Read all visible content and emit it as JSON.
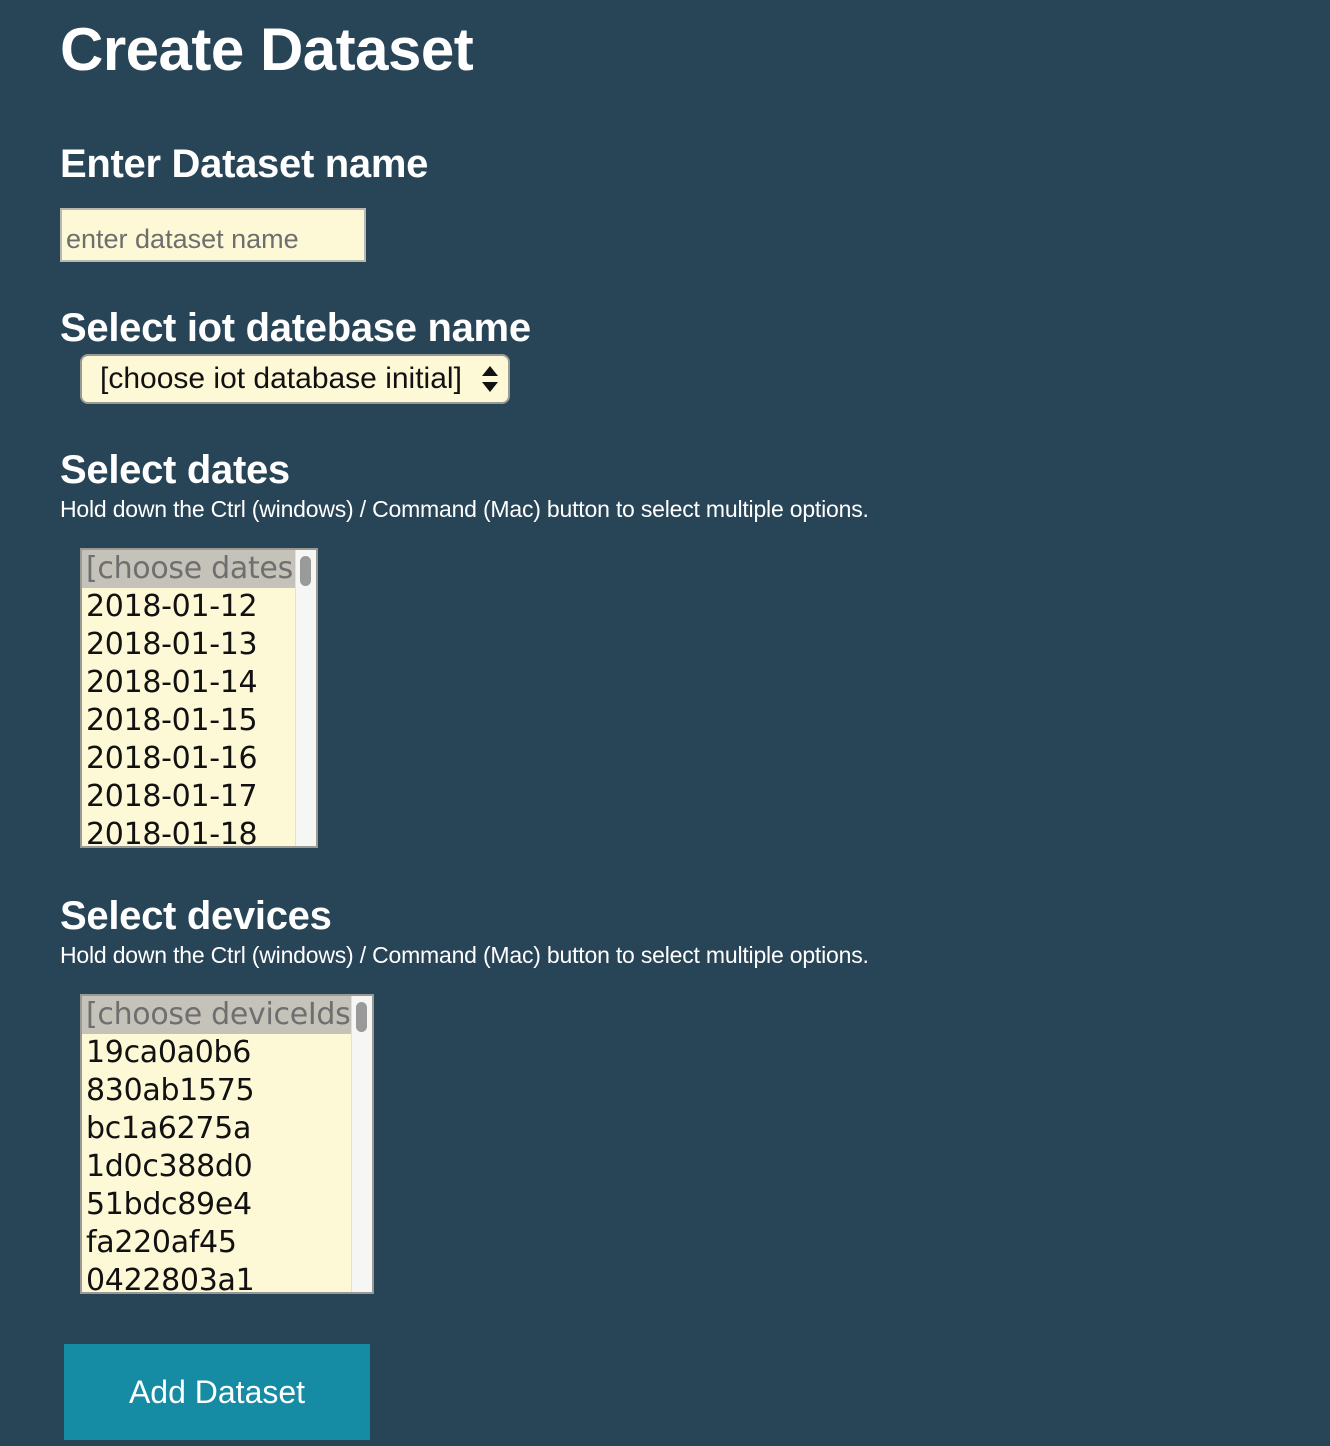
{
  "page": {
    "title": "Create Dataset"
  },
  "dataset_name": {
    "heading": "Enter Dataset name",
    "placeholder": "enter dataset name",
    "value": ""
  },
  "database": {
    "heading": "Select iot datebase name",
    "selected": "[choose iot database initial]"
  },
  "dates": {
    "heading": "Select dates",
    "hint": "Hold down the Ctrl (windows) / Command (Mac) button to select multiple options.",
    "options": [
      "[choose dates]",
      "2018-01-12",
      "2018-01-13",
      "2018-01-14",
      "2018-01-15",
      "2018-01-16",
      "2018-01-17",
      "2018-01-18"
    ]
  },
  "devices": {
    "heading": "Select devices",
    "hint": "Hold down the Ctrl (windows) / Command (Mac) button to select multiple options.",
    "options": [
      "[choose deviceIds]",
      "19ca0a0b6",
      "830ab1575",
      "bc1a6275a",
      "1d0c388d0",
      "51bdc89e4",
      "fa220af45",
      "0422803a1"
    ]
  },
  "actions": {
    "add_label": "Add Dataset"
  },
  "colors": {
    "background": "#284457",
    "field": "#fdf8d6",
    "button": "#168ba4"
  },
  "icons": {
    "select_arrows": "updown-arrows-icon"
  }
}
